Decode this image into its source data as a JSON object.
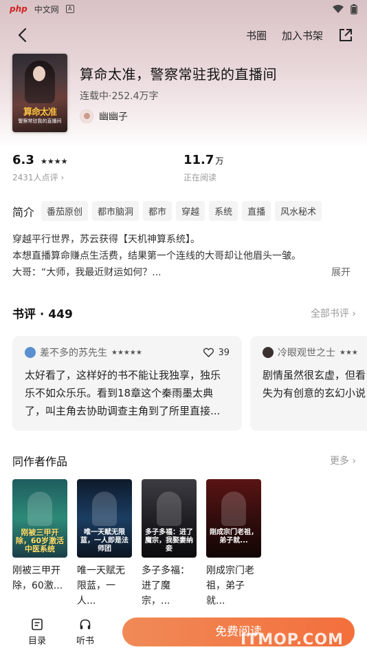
{
  "status_bar": {
    "logo": "php",
    "site": "中文网",
    "badge": "A"
  },
  "nav": {
    "circle_label": "书圈",
    "shelf_label": "加入书架"
  },
  "book": {
    "title": "算命太准，警察常驻我的直播间",
    "meta": "连载中·252.4万字",
    "author": "幽幽子",
    "cover_title": "算命太准",
    "cover_sub": "警察常驻我的直播间"
  },
  "stats": {
    "rating": "6.3",
    "rating_stars": "★★★★",
    "rating_count": "2431人点评 ›",
    "reads": "11.7",
    "reads_unit": "万",
    "reads_label": "正在阅读"
  },
  "intro": {
    "label": "简介",
    "tags": [
      "番茄原创",
      "都市脑洞",
      "都市",
      "穿越",
      "系统",
      "直播",
      "风水秘术"
    ],
    "lines": [
      "穿越平行世界，苏云获得【天机神算系统】。",
      "本想直播算命赚点生活费，结果第一个连线的大哥却让他眉头一皱。",
      "大哥：“大师，我最近财运如何？..."
    ],
    "expand_label": "展开"
  },
  "reviews_section": {
    "title": "书评 · 449",
    "more": "全部书评 ›",
    "items": [
      {
        "name": "差不多的苏先生",
        "stars": "★★★★★",
        "likes": "39",
        "lines": [
          "太好看了，这样好的书不能让我独享，独乐",
          "乐不如众乐乐。看到18章这个秦雨墨太典",
          "了，叫主角去协助调查主角到了所里直接..."
        ]
      },
      {
        "name": "冷眼观世之士",
        "stars": "★★★",
        "likes": "",
        "lines": [
          "剧情虽然很玄虚，但看",
          "失为有创意的玄幻小说"
        ]
      }
    ]
  },
  "works_section": {
    "title": "同作者作品",
    "more": "更多 ›",
    "items": [
      {
        "cover_text": "刚被三甲开除，60岁激活中医系统",
        "title_l1": "刚被三甲开",
        "title_l2": "除，60激..."
      },
      {
        "cover_text": "唯一天赋无限蓝，一人即是法师团",
        "title_l1": "唯一天赋无",
        "title_l2": "限蓝，一人..."
      },
      {
        "cover_text": "多子多福：进了魔宗，我娶妻纳妾",
        "title_l1": "多子多福：",
        "title_l2": "进了魔宗，..."
      },
      {
        "cover_text": "刚成宗门老祖，弟子就...",
        "title_l1": "刚成宗门老",
        "title_l2": "祖，弟子就..."
      }
    ]
  },
  "bottom_bar": {
    "toc_label": "目录",
    "listen_label": "听书",
    "read_label": "免费阅读",
    "watermark": "ITMOP.COM"
  },
  "colors": {
    "accent": "#f36f3c",
    "hero_bg": "#e8d6d8"
  }
}
